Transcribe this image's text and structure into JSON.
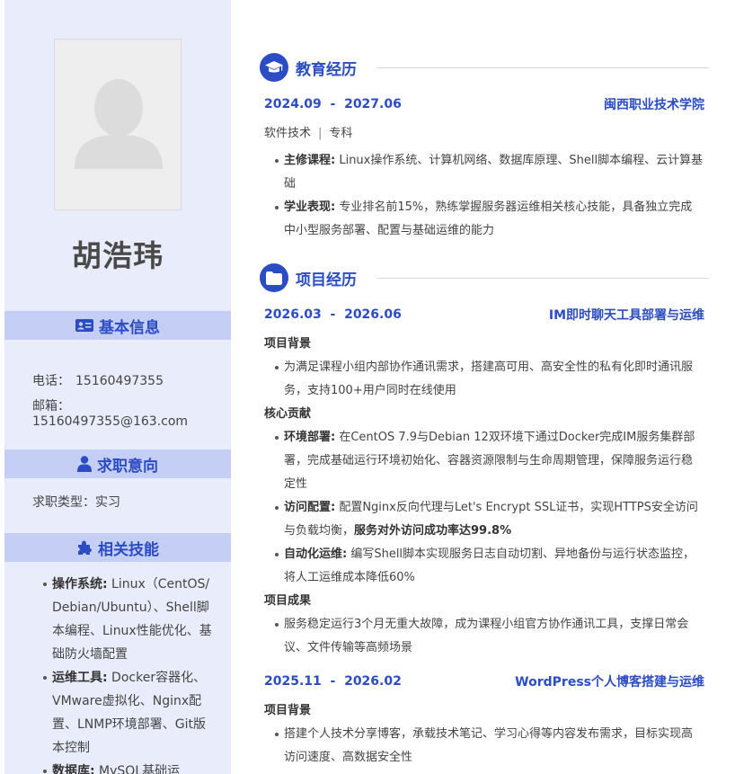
{
  "profile": {
    "name": "胡浩玮"
  },
  "sidebar": {
    "basic_info": {
      "title": "基本信息",
      "phone_label": "电话：",
      "phone": "15160497355",
      "email_label": "邮箱：",
      "email": "15160497355@163.com"
    },
    "intention": {
      "title": "求职意向",
      "type_label": "求职类型：",
      "type": "实习"
    },
    "skills": {
      "title": "相关技能",
      "items": [
        {
          "label": "操作系统:",
          "text": " Linux（CentOS/Debian/Ubuntu）、Shell脚本编程、Linux性能优化、基础防火墙配置"
        },
        {
          "label": "运维工具:",
          "text": " Docker容器化、VMware虚拟化、Nginx配置、LNMP环境部署、Git版本控制"
        },
        {
          "label": "数据库:",
          "text": " MySQL基础运"
        }
      ]
    }
  },
  "education": {
    "title": "教育经历",
    "date_start": "2024.09",
    "date_end": "2027.06",
    "school": "闽西职业技术学院",
    "major": "软件技术",
    "degree": "专科",
    "bullets": [
      {
        "label": "主修课程:",
        "text": " Linux操作系统、计算机网络、数据库原理、Shell脚本编程、云计算基础"
      },
      {
        "label": "学业表现:",
        "text": " 专业排名前15%，熟练掌握服务器运维相关核心技能，具备独立完成中小型服务部署、配置与基础运维的能力"
      }
    ]
  },
  "projects": {
    "title": "项目经历",
    "background_label": "项目背景",
    "contribution_label": "核心贡献",
    "result_label": "项目成果",
    "items": [
      {
        "date_start": "2026.03",
        "date_end": "2026.06",
        "name": "IM即时聊天工具部署与运维",
        "background": "为满足课程小组内部协作通讯需求，搭建高可用、高安全性的私有化即时通讯服务，支持100+用户同时在线使用",
        "contributions": [
          {
            "label": "环境部署:",
            "text": " 在CentOS 7.9与Debian 12双环境下通过Docker完成IM服务集群部署，完成基础运行环境初始化、容器资源限制与生命周期管理，保障服务运行稳定性"
          },
          {
            "label": "访问配置:",
            "text": " 配置Nginx反向代理与Let's Encrypt SSL证书，实现HTTPS安全访问与负载均衡，",
            "strong": "服务对外访问成功率达99.8%"
          },
          {
            "label": "自动化运维:",
            "text": " 编写Shell脚本实现服务日志自动切割、异地备份与运行状态监控，将人工运维成本降低60%"
          }
        ],
        "result": "服务稳定运行3个月无重大故障，成为课程小组官方协作通讯工具，支撑日常会议、文件传输等高频场景"
      },
      {
        "date_start": "2025.11",
        "date_end": "2026.02",
        "name": "WordPress个人博客搭建与运维",
        "background": "搭建个人技术分享博客，承载技术笔记、学习心得等内容发布需求，目标实现高访问速度、高数据安全性"
      }
    ]
  },
  "date_separator": "-",
  "colors": {
    "accent": "#2b4cc2",
    "sidebar_bg": "#e9edfb",
    "sidebar_header_bg": "#c5cef5"
  }
}
